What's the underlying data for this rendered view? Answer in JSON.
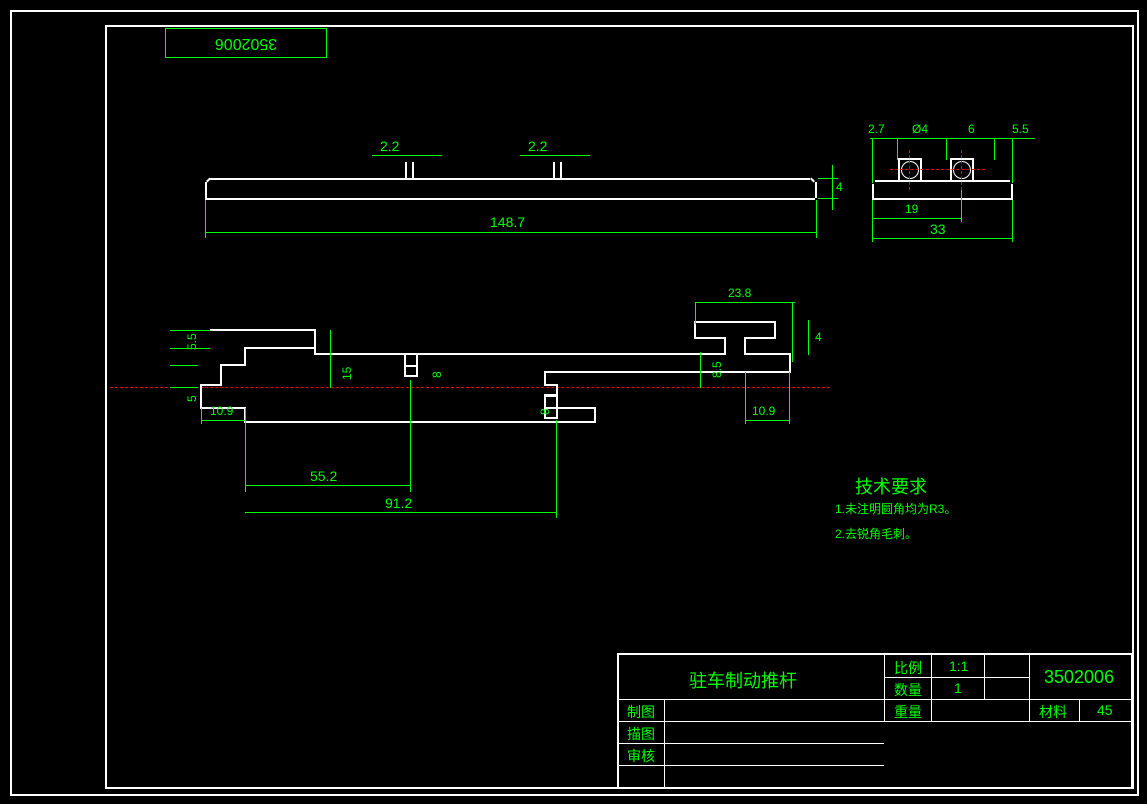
{
  "part_id": "3502006",
  "dims_top_view": {
    "pin_width_1": "2.2",
    "pin_width_2": "2.2",
    "overall_length": "148.7",
    "thickness": "4"
  },
  "dims_end_view": {
    "left_offset": "2.7",
    "hole_dia": "Ø4",
    "gap": "6",
    "right_offset": "5.5",
    "hole_spacing": "19",
    "overall_width": "33"
  },
  "dims_plan_view": {
    "notch_left": "10.9",
    "notch_right": "10.9",
    "dim_55": "5.5",
    "dim_5": "5",
    "dim_15": "15",
    "dim_8": "8",
    "dim_8b": "8",
    "dim_85": "8.5",
    "dim_4": "4",
    "dim_238": "23.8",
    "span_552": "55.2",
    "span_912": "91.2"
  },
  "tech_req": {
    "title": "技术要求",
    "item1": "1.未注明圆角均为R3。",
    "item2": "2.去锐角毛刺。"
  },
  "title_block": {
    "part_name": "驻车制动推杆",
    "scale_label": "比例",
    "scale_value": "1:1",
    "qty_label": "数量",
    "qty_value": "1",
    "drawing_no": "3502006",
    "drawn_label": "制图",
    "weight_label": "重量",
    "material_label": "材料",
    "material_value": "45",
    "trace_label": "描图",
    "check_label": "审核"
  }
}
